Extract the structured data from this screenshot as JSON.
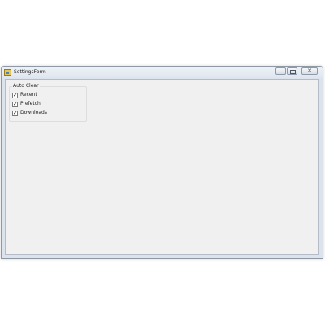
{
  "window": {
    "title": "SettingsForm",
    "minimize_icon": "minimize-icon",
    "maximize_icon": "maximize-icon",
    "close_icon": "close-icon",
    "close_glyph": "✕"
  },
  "auto_clear": {
    "title": "Auto Clear",
    "options": [
      {
        "label": "Recent",
        "checked": true
      },
      {
        "label": "Prefetch",
        "checked": true
      },
      {
        "label": "Downloads",
        "checked": true
      }
    ],
    "check_glyph": "✓"
  },
  "colors": {
    "client_background": "#f0f0f0",
    "frame": "#dce3ec"
  }
}
